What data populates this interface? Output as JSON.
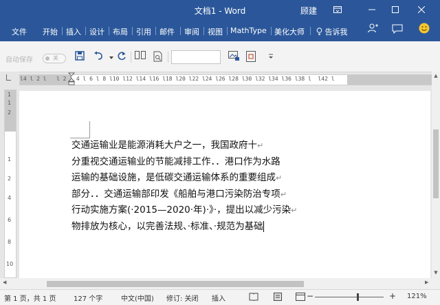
{
  "window": {
    "title": "文档1  -  Word",
    "user": "顾建",
    "ribbon_display_icon": "ribbon-display-icon",
    "minimize_icon": "minimize-icon",
    "maximize_icon": "maximize-icon",
    "close_icon": "close-icon"
  },
  "menu": {
    "items": [
      "文件",
      "开始",
      "插入",
      "设计",
      "布局",
      "引用",
      "邮件",
      "审阅",
      "视图",
      "MathType",
      "美化大师"
    ],
    "tell_me": "告诉我",
    "tell_me_icon": "lightbulb-icon",
    "share_icon": "share-person-icon",
    "comment_icon": "comment-icon",
    "smiley_icon": "smiley-icon"
  },
  "toolbar": {
    "autosave_label": "自动保存",
    "autosave_state": "关",
    "icons": [
      "save-icon",
      "undo-icon",
      "redo-icon",
      "columns-icon",
      "print-preview-icon",
      "font-box",
      "insert-picture-icon",
      "insert-table-icon",
      "customize-dropdown-icon"
    ]
  },
  "document": {
    "lines": [
      "交通运输业是能源消耗大户之一，我国政府十",
      "分重视交通运输业的节能减排工作．．港口作为水路",
      "运输的基础设施，是低碳交通运输体系的重要组成",
      "部分．．交通运输部印发《船舶与港口污染防治专项",
      "行动实施方案(·2015—2020·年)·》·，提出以减少污染",
      "物排放为核心，以完善法规、·标准、·规范为基础"
    ],
    "paragraph_mark": "↵"
  },
  "ruler": {
    "horizontal": "l4 l 2 l   l 2 l 4 l 6 l 8 l10 l12 l14 l16 l18 l20 l22 l24 l26 l28 l30 l32 l34 l36 l38 l  l42 l",
    "vertical": [
      "1",
      "1",
      "2",
      "1",
      "2",
      "4",
      "6",
      "8",
      "10"
    ]
  },
  "status": {
    "page": "第 1 页，共 1 页",
    "words": "127 个字",
    "language": "中文(中国)",
    "track_changes": "修订: 关闭",
    "insert_mode": "插入",
    "zoom": "121%",
    "zoom_minus": "−",
    "zoom_plus": "+"
  },
  "colors": {
    "accent": "#2b579a"
  }
}
